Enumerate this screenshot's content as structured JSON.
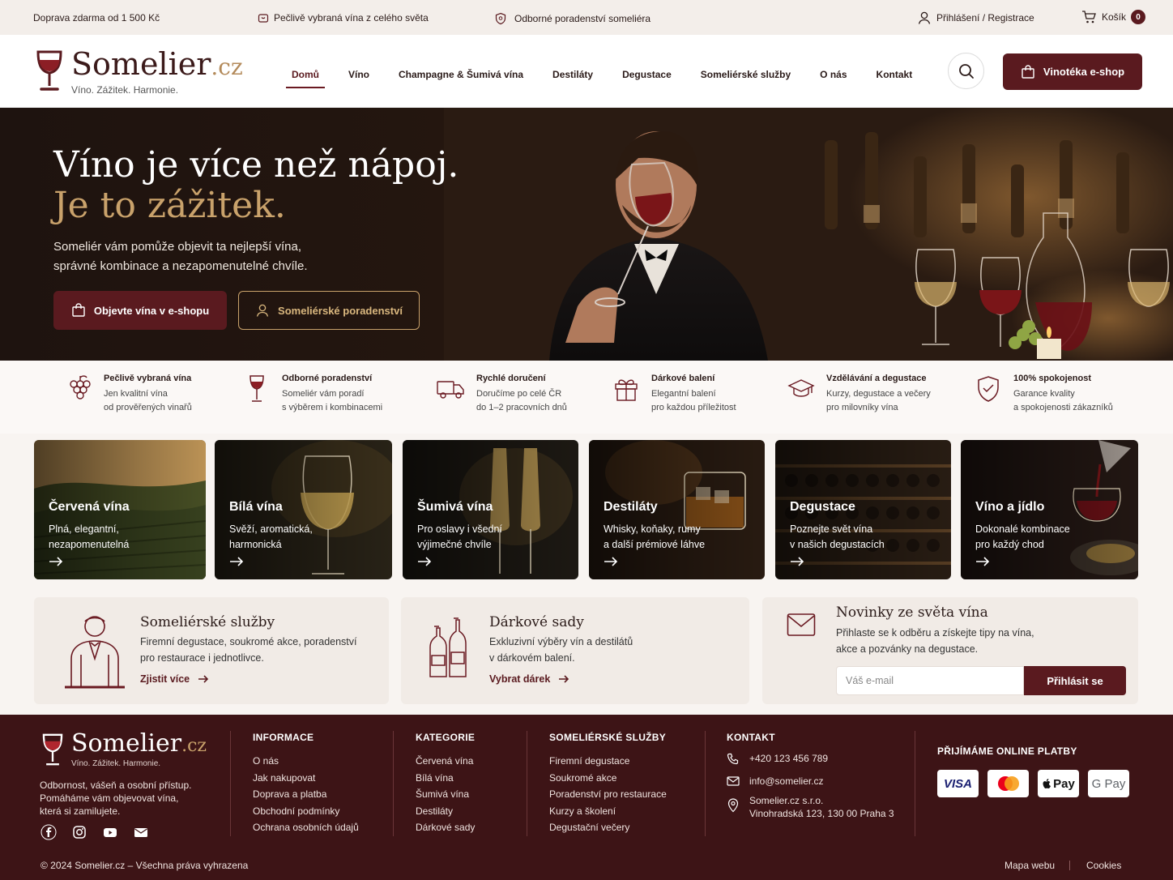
{
  "topbar": {
    "shipping": "Doprava zdarma od 1 500 Kč",
    "wines": "Pečlivě vybraná vína z celého světa",
    "advice": "Odborné poradenství someliéra",
    "login": "Přihlášení / Registrace",
    "cart": "Košík",
    "cart_count": "0"
  },
  "header": {
    "logo_name": "Somelier",
    "logo_tld": ".cz",
    "logo_tagline": "Víno. Zážitek. Harmonie.",
    "nav": [
      "Domů",
      "Víno",
      "Champagne & Šumivá vína",
      "Destiláty",
      "Degustace",
      "Someliérské služby",
      "O nás",
      "Kontakt"
    ],
    "shop_button": "Vinotéka e-shop"
  },
  "hero": {
    "title_line1": "Víno je více než nápoj.",
    "title_line2": "Je to zážitek.",
    "subtitle": "Someliér vám pomůže objevit ta nejlepší vína, správné kombinace a nezapomenutelné chvíle.",
    "button_shop": "Objevte vína v e-shopu",
    "button_advice": "Someliérské poradenství"
  },
  "features": [
    {
      "icon": "grapes-icon",
      "title": "Pečlivě vybraná vína",
      "line1": "Jen kvalitní vína",
      "line2": "od prověřených vinařů"
    },
    {
      "icon": "wine-glass-icon",
      "title": "Odborné poradenství",
      "line1": "Someliér vám poradí",
      "line2": "s výběrem i kombinacemi"
    },
    {
      "icon": "truck-icon",
      "title": "Rychlé doručení",
      "line1": "Doručíme po celé ČR",
      "line2": "do 1–2 pracovních dnů"
    },
    {
      "icon": "gift-icon",
      "title": "Dárkové balení",
      "line1": "Elegantní balení",
      "line2": "pro každou příležitost"
    },
    {
      "icon": "graduation-cap-icon",
      "title": "Vzdělávání a degustace",
      "line1": "Kurzy, degustace a večery",
      "line2": "pro milovníky vína"
    },
    {
      "icon": "shield-check-icon",
      "title": "100% spokojenost",
      "line1": "Garance kvality",
      "line2": "a spokojenosti zákazníků"
    }
  ],
  "categories": [
    {
      "title": "Červená vína",
      "line1": "Plná, elegantní,",
      "line2": "nezapomenutelná"
    },
    {
      "title": "Bílá vína",
      "line1": "Svěží, aromatická,",
      "line2": "harmonická"
    },
    {
      "title": "Šumivá vína",
      "line1": "Pro oslavy i všední",
      "line2": "výjimečné chvíle"
    },
    {
      "title": "Destiláty",
      "line1": "Whisky, koňaky, rumy",
      "line2": "a další prémiové láhve"
    },
    {
      "title": "Degustace",
      "line1": "Poznejte svět vína",
      "line2": "v našich degustacích"
    },
    {
      "title": "Víno a jídlo",
      "line1": "Dokonalé kombinace",
      "line2": "pro každý chod"
    }
  ],
  "services": {
    "title": "Someliérské služby",
    "line1": "Firemní degustace, soukromé akce, poradenství",
    "line2": "pro restaurace i jednotlivce.",
    "link": "Zjistit více"
  },
  "gifts": {
    "title": "Dárkové sady",
    "line1": "Exkluzivní výběry vín a destilátů",
    "line2": "v dárkovém balení.",
    "link": "Vybrat dárek"
  },
  "newsletter": {
    "title": "Novinky ze světa vína",
    "line1": "Přihlaste se k odběru a získejte tipy na vína,",
    "line2": "akce a pozvánky na degustace.",
    "placeholder": "Váš e-mail",
    "button": "Přihlásit se"
  },
  "footer": {
    "about_line1": "Odbornost, vášeň a osobní přístup.",
    "about_line2": "Pomáháme vám objevovat vína,",
    "about_line3": "která si zamilujete.",
    "info_title": "INFORMACE",
    "info_links": [
      "O nás",
      "Jak nakupovat",
      "Doprava a platba",
      "Obchodní podmínky",
      "Ochrana osobních údajů"
    ],
    "cat_title": "KATEGORIE",
    "cat_links": [
      "Červená vína",
      "Bílá vína",
      "Šumivá vína",
      "Destiláty",
      "Dárkové sady"
    ],
    "serv_title": "SOMELIÉRSKÉ SLUŽBY",
    "serv_links": [
      "Firemní degustace",
      "Soukromé akce",
      "Poradenství pro restaurace",
      "Kurzy a školení",
      "Degustační večery"
    ],
    "contact_title": "KONTAKT",
    "phone": "+420 123 456 789",
    "email": "info@somelier.cz",
    "company": "Somelier.cz s.r.o.",
    "address": "Vinohradská 123, 130 00 Praha 3",
    "payments_title": "PŘIJÍMÁME ONLINE PLATBY",
    "payments": [
      "VISA",
      "Mastercard",
      "Pay",
      "G Pay"
    ],
    "copyright": "© 2024 Somelier.cz – Všechna práva vyhrazena",
    "sitemap": "Mapa webu",
    "cookies": "Cookies"
  },
  "colors": {
    "brand": "#5a1a1f",
    "gold": "#c9a26b",
    "footer": "#3d1416"
  }
}
